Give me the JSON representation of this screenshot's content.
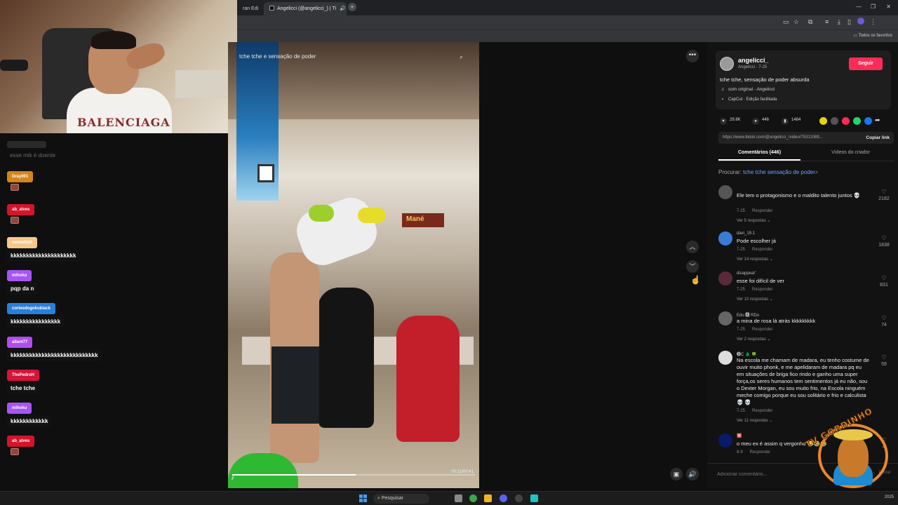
{
  "browser": {
    "tabs": [
      {
        "label": "ran Edi",
        "active": false
      },
      {
        "label": "Angelicci (@angelicci_) | Ti",
        "active": true
      }
    ],
    "bookmarks_label": "Todos os favoritos"
  },
  "chat": {
    "faded_message": "esse mik é doente",
    "messages": [
      {
        "user": "Dray001",
        "color": "#d4851d",
        "text": "",
        "emote": true
      },
      {
        "user": "ab_alves",
        "color": "#d5142b",
        "text": "",
        "emote": true
      },
      {
        "user": "senseilish",
        "color": "#f5c88a",
        "text": "kkkkkkkkkkkkkkkkkkkkk",
        "emote": false
      },
      {
        "user": "mihoku",
        "color": "#a855f7",
        "text": "pqp da n",
        "emote": false
      },
      {
        "user": "cortesdogokublack",
        "color": "#2a7fd9",
        "text": "kkkkkkkkkkkkkkkk",
        "emote": false
      },
      {
        "user": "allant77",
        "color": "#b14cf0",
        "text": "kkkkkkkkkkkkkkkkkkkkkkkkkkkk",
        "emote": false
      },
      {
        "user": "ThePedroH",
        "color": "#d5143b",
        "text": "tche tche",
        "emote": false
      },
      {
        "user": "mihoku",
        "color": "#a855f7",
        "text": "kkkkkkkkkkkk",
        "emote": false
      },
      {
        "user": "ab_alves",
        "color": "#d5142b",
        "text": "",
        "emote": true
      }
    ]
  },
  "webcam": {
    "shirt_logo": "BALENCIAGA"
  },
  "video": {
    "search_text": "tche tche e sensação de poder",
    "time": "00:21/00:41",
    "progress": 0.51,
    "sign_text": "Mané"
  },
  "author": {
    "handle": "angelicci_",
    "subtitle": "Angelicci · 7-25",
    "follow_label": "Seguir",
    "caption": "tche tche, sensação de poder absurda",
    "sound": "som original - Angelicci",
    "capcut": "CapCut · Edição facilitada"
  },
  "stats": {
    "likes": "29.8K",
    "comments": "446",
    "saves": "1484"
  },
  "share_colors": [
    "#e6d20e",
    "#555555",
    "#fe2c55",
    "#25d366",
    "#1877f2"
  ],
  "link": {
    "url": "https://www.tiktok.com/@angelicci_/video/75311089...",
    "copy_label": "Copiar link"
  },
  "tabs": {
    "comments": "Comentários (446)",
    "videos": "Vídeos do criador"
  },
  "search": {
    "label": "Procurar:",
    "query": "tche tche sensação de poder"
  },
  "comments": [
    {
      "user": "",
      "text": "Ele tem o protagonismo e o maldito talento juntos 💀",
      "date": "7-25",
      "reply": "Responder",
      "replies": "Ver 5 respostas ⌄",
      "likes": "2182",
      "avatar": "#555555"
    },
    {
      "user": "davi_19.1",
      "text": "Pode escolher já",
      "date": "7-25",
      "reply": "Responder",
      "replies": "Ver 14 respostas ⌄",
      "likes": "1838",
      "avatar": "#3a7bd5"
    },
    {
      "user": "disappear'",
      "text": "esse foi difícil de ver",
      "date": "7-25",
      "reply": "Responder",
      "replies": "Ver 10 respostas ⌄",
      "likes": "831",
      "avatar": "#5a2a3a"
    },
    {
      "user": "Edu 🅰 RDo",
      "text": "a mina de rosa lá atrás kkkkkkkkk",
      "date": "7-25",
      "reply": "Responder",
      "replies": "Ver 2 respostas ⌄",
      "likes": "74",
      "avatar": "#666666"
    },
    {
      "user": "🅓C 🌲 🍀",
      "text": "Na escola me chamam de madara, eu tenho costume de ouvir muito phonk, e me apelidaram de madara pq eu em situações de briga fico rindo e ganho uma super força,os seres humanos tem sentimentos já eu não, sou o Dexter Morgan, eu sou muito frio, na Escola ninguém meche comigo porque eu sou solitário e frio e calculista💀 💀",
      "date": "7-25",
      "reply": "Responder",
      "replies": "Ver 11 respostas ⌄",
      "likes": "59",
      "avatar": "#dddddd"
    },
    {
      "user": "🈲",
      "text": "o meu ex é assim q vergonha 😂😂😂",
      "date": "8-9",
      "reply": "Responder",
      "replies": "",
      "likes": "4",
      "avatar": "#0a1a6a"
    }
  ],
  "add_comment": {
    "placeholder": "Adicionar comentário...",
    "post_label": "Postar"
  },
  "taskbar": {
    "search_label": "Pesquisar",
    "tray": "2025"
  },
  "stream_logo": {
    "text": "TV GORDINHO"
  }
}
